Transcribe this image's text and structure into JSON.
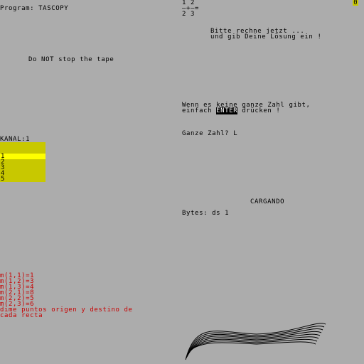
{
  "program": {
    "label": "Program: TASCOPY"
  },
  "badge": {
    "value": "0"
  },
  "fraction": {
    "numerators": "1 2",
    "line2": "—+—=",
    "denominators": "2 3"
  },
  "quiz": {
    "line1": "Bitte rechne jetzt ...",
    "line2": "und gib Deine Lösung ein !",
    "hint1": "Wenn es keine ganze Zahl gibt,",
    "hint2_before": "einfach ",
    "hint2_key": "ENTER",
    "hint2_after": " drücken !",
    "prompt": "Ganze Zahl? L"
  },
  "tape_msg": "Do NOT stop the tape",
  "kanal": {
    "label": "KANAL:1",
    "channels": [
      "1",
      "2",
      "3",
      "4",
      "5"
    ],
    "selected": "1"
  },
  "loader": {
    "status": "CARGANDO",
    "bytes": "Bytes: ds 1"
  },
  "matrix": {
    "lines": [
      "m(1,1)=1",
      "m(1,2)=3",
      "m(1,3)=4",
      "m(2,1)=8",
      "m(2,2)=5",
      "m(2,3)=6",
      "dime puntos origen y destino de",
      "cada recta"
    ]
  },
  "colors": {
    "background": "#acacac",
    "ink": "#000000",
    "red": "#c80000",
    "yellow": "#c8c800",
    "highlight": "#ffff00"
  },
  "icons": {
    "wave": "wave-curves-graphic"
  }
}
